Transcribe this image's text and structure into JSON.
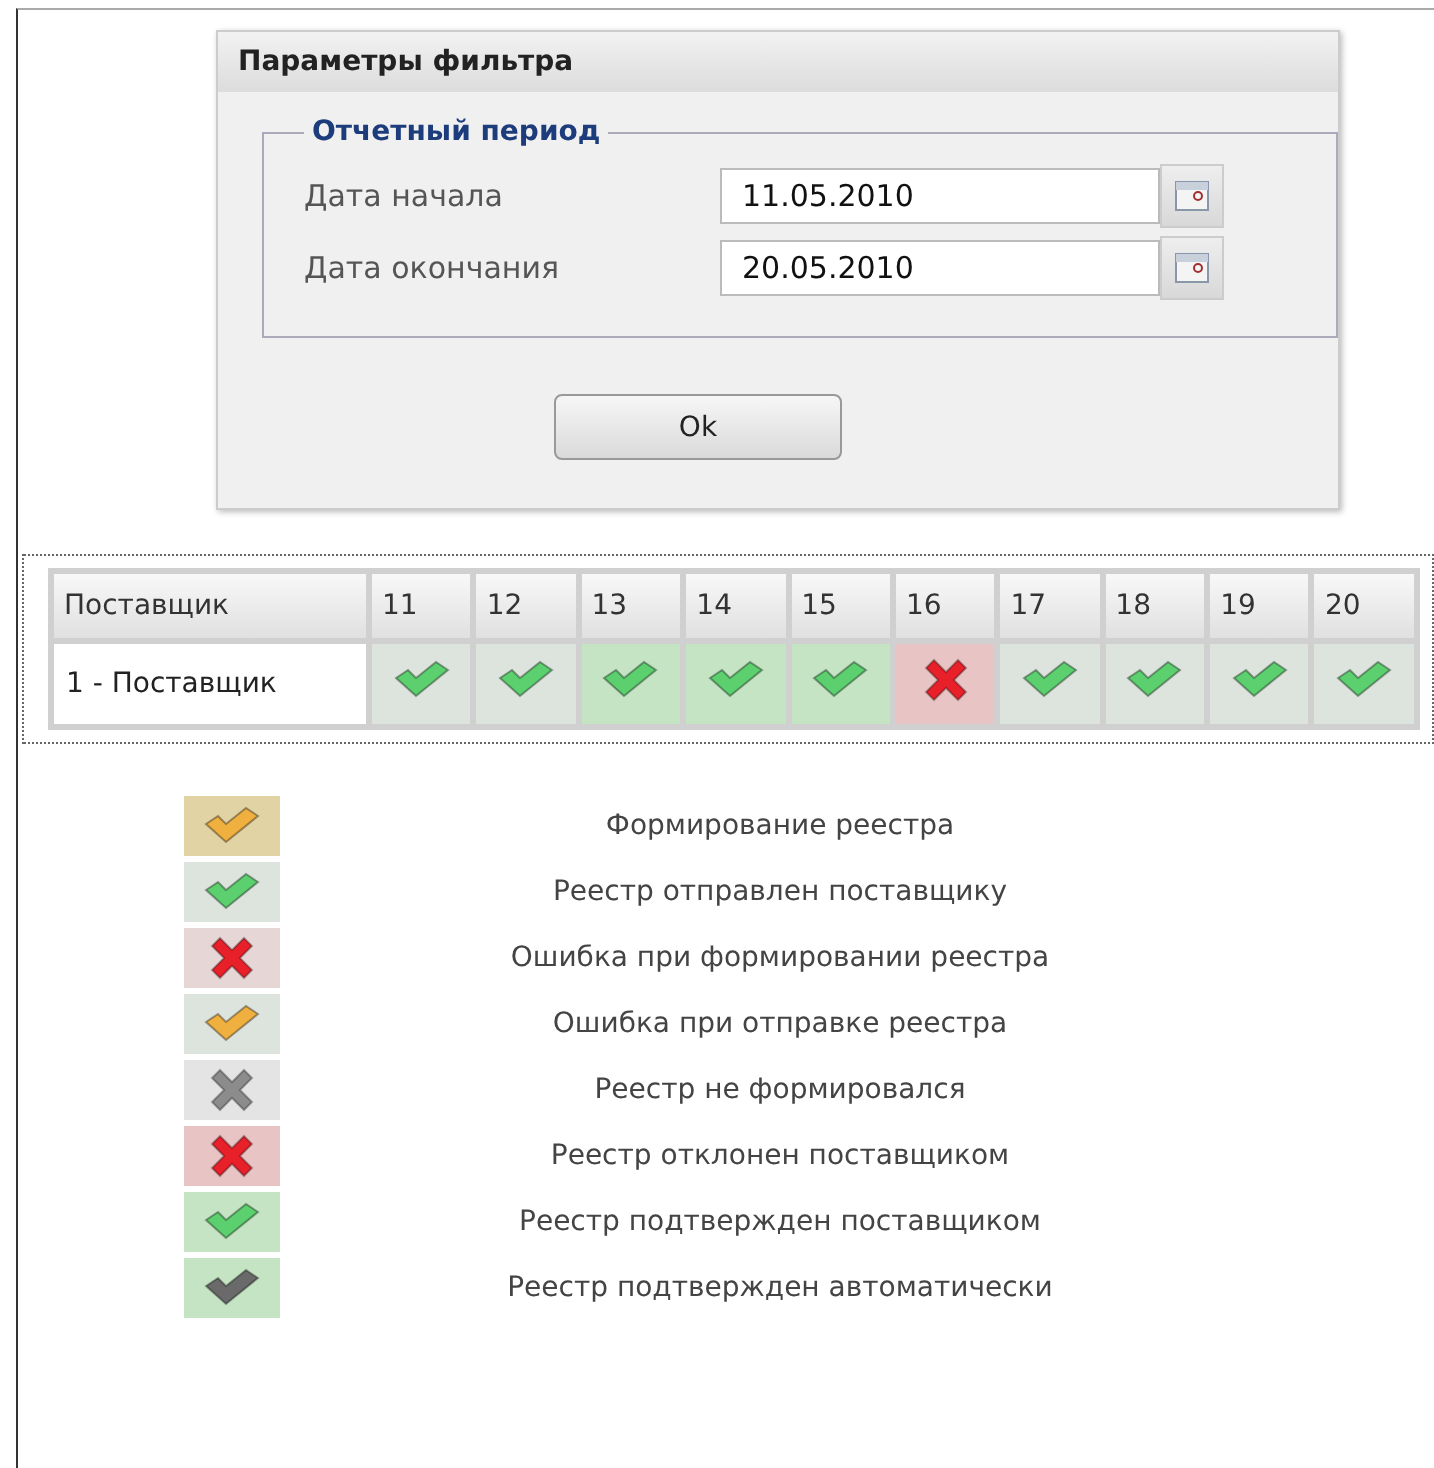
{
  "dialog": {
    "title": "Параметры фильтра",
    "group": {
      "legend": "Отчетный период",
      "fields": [
        {
          "label": "Дата начала",
          "value": "11.05.2010"
        },
        {
          "label": "Дата окончания",
          "value": "20.05.2010"
        }
      ]
    },
    "button": "Ok"
  },
  "grid": {
    "columns": [
      "Поставщик",
      "11",
      "12",
      "13",
      "14",
      "15",
      "16",
      "17",
      "18",
      "19",
      "20"
    ],
    "rows": [
      {
        "supplier": "1 - Поставщик",
        "cells": [
          {
            "kind": "sent"
          },
          {
            "kind": "sent"
          },
          {
            "kind": "confirmed"
          },
          {
            "kind": "confirmed"
          },
          {
            "kind": "confirmed"
          },
          {
            "kind": "rejected"
          },
          {
            "kind": "sent"
          },
          {
            "kind": "sent"
          },
          {
            "kind": "sent"
          },
          {
            "kind": "sent"
          }
        ]
      }
    ]
  },
  "legend": [
    {
      "kind": "forming",
      "label": "Формирование реестра"
    },
    {
      "kind": "sent",
      "label": "Реестр отправлен поставщику"
    },
    {
      "kind": "form_error",
      "label": "Ошибка при формировании реестра"
    },
    {
      "kind": "send_error",
      "label": "Ошибка при отправке реестра"
    },
    {
      "kind": "not_formed",
      "label": "Реестр не формировался"
    },
    {
      "kind": "rejected",
      "label": "Реестр отклонен поставщиком"
    },
    {
      "kind": "confirmed",
      "label": "Реестр подтвержден поставщиком"
    },
    {
      "kind": "auto_confirmed",
      "label": "Реестр подтвержден автоматически"
    }
  ]
}
